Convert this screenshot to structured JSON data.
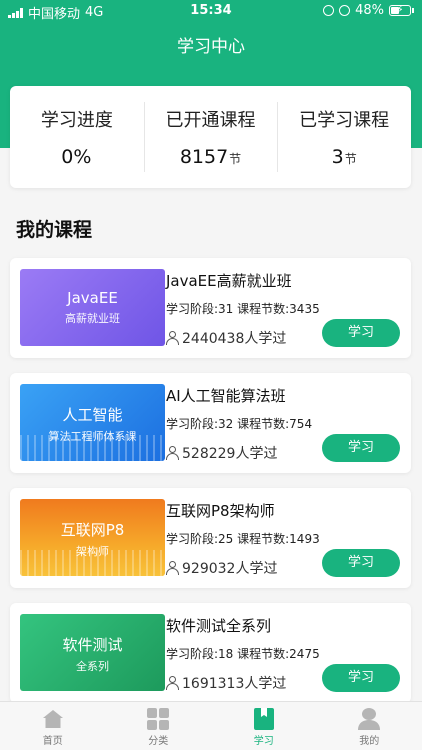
{
  "status_bar": {
    "carrier": "中国移动",
    "network": "4G",
    "time": "15:34",
    "battery": "48%"
  },
  "header": {
    "title": "学习中心"
  },
  "stats": [
    {
      "label": "学习进度",
      "value": "0%",
      "unit": ""
    },
    {
      "label": "已开通课程",
      "value": "8157",
      "unit": "节"
    },
    {
      "label": "已学习课程",
      "value": "3",
      "unit": "节"
    }
  ],
  "section": {
    "title": "我的课程"
  },
  "courses": [
    {
      "cover_title": "JavaEE",
      "cover_sub": "高薪就业班",
      "name": "JavaEE高薪就业班",
      "meta": "学习阶段:31  课程节数:3435",
      "learners": "2440438人学过",
      "button": "学习",
      "cover_color": "#8a6cf0"
    },
    {
      "cover_title": "人工智能",
      "cover_sub": "算法工程师体系课",
      "name": "AI人工智能算法班",
      "meta": "学习阶段:32  课程节数:754",
      "learners": "528229人学过",
      "button": "学习",
      "cover_color": "#2b8ef0"
    },
    {
      "cover_title": "互联网P8",
      "cover_sub": "架构师",
      "name": "互联网P8架构师",
      "meta": "学习阶段:25  课程节数:1493",
      "learners": "929032人学过",
      "button": "学习",
      "cover_color": "#f3921f"
    },
    {
      "cover_title": "软件测试",
      "cover_sub": "全系列",
      "name": "软件测试全系列",
      "meta": "学习阶段:18  课程节数:2475",
      "learners": "1691313人学过",
      "button": "学习",
      "cover_color": "#22b06e"
    }
  ],
  "tabbar": [
    {
      "label": "首页",
      "icon": "home-icon"
    },
    {
      "label": "分类",
      "icon": "category-icon"
    },
    {
      "label": "学习",
      "icon": "study-icon",
      "active": true
    },
    {
      "label": "我的",
      "icon": "profile-icon"
    }
  ],
  "colors": {
    "accent": "#19b37f",
    "background": "#f5f5f5"
  }
}
